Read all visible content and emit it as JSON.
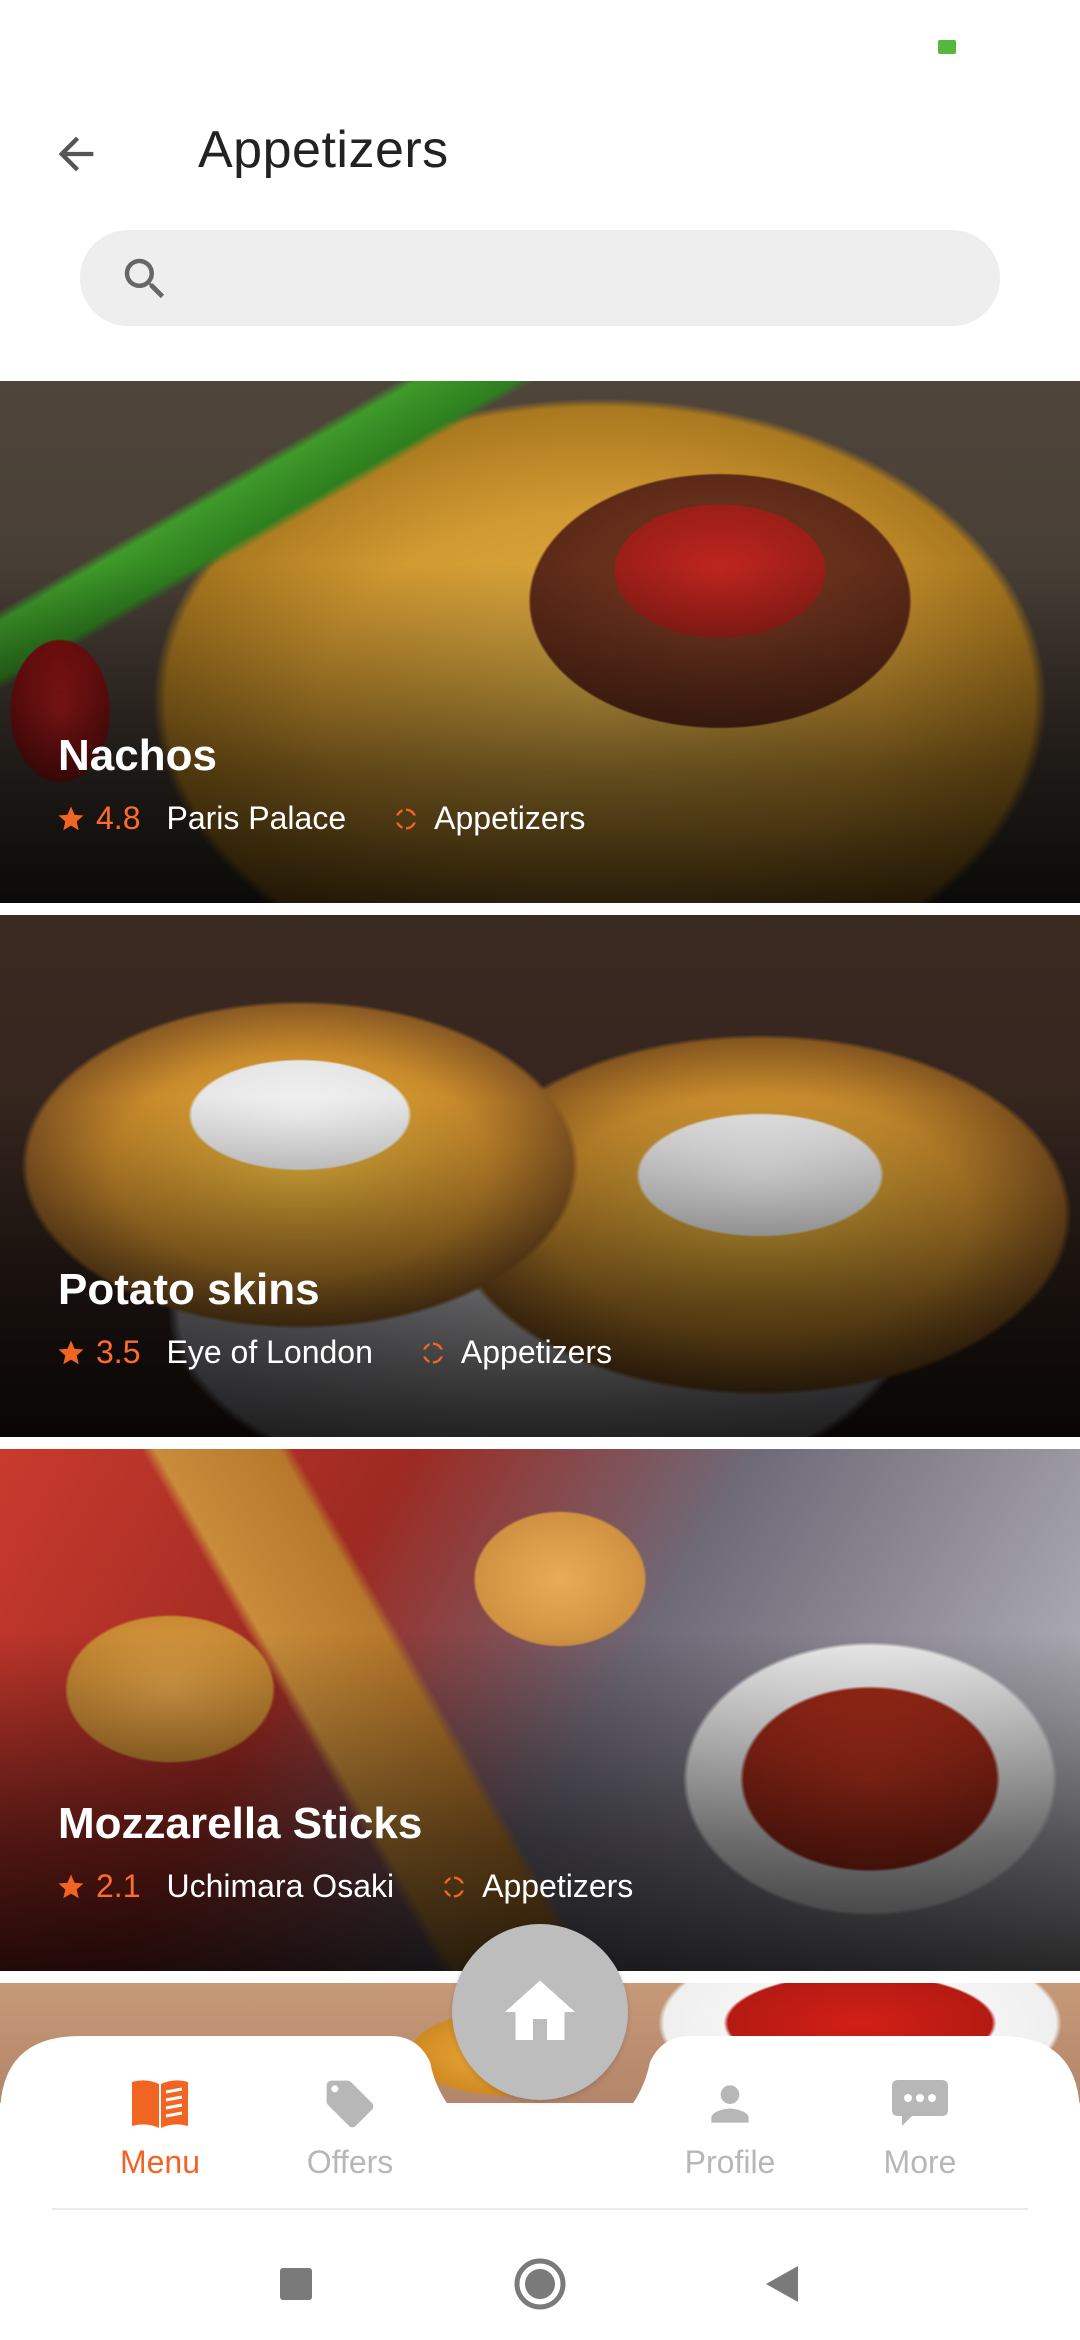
{
  "header": {
    "title": "Appetizers"
  },
  "search": {
    "placeholder": ""
  },
  "items": [
    {
      "name": "Nachos",
      "rating": "4.8",
      "restaurant": "Paris Palace",
      "category": "Appetizers"
    },
    {
      "name": "Potato skins",
      "rating": "3.5",
      "restaurant": "Eye of London",
      "category": "Appetizers"
    },
    {
      "name": "Mozzarella Sticks",
      "rating": "2.1",
      "restaurant": "Uchimara Osaki",
      "category": "Appetizers"
    }
  ],
  "bottom_nav": {
    "menu": "Menu",
    "offers": "Offers",
    "profile": "Profile",
    "more": "More"
  },
  "colors": {
    "accent": "#f16422",
    "inactive": "#b7b7b7",
    "fab": "#bdbdbd",
    "battery": "#55b83d"
  },
  "icons": {
    "back": "arrow-left-icon",
    "search": "search-icon",
    "star": "star-icon",
    "category": "circle-arrows-icon",
    "menu": "book-icon",
    "offers": "tag-icon",
    "home": "home-icon",
    "profile": "person-icon",
    "more": "chat-more-icon"
  }
}
